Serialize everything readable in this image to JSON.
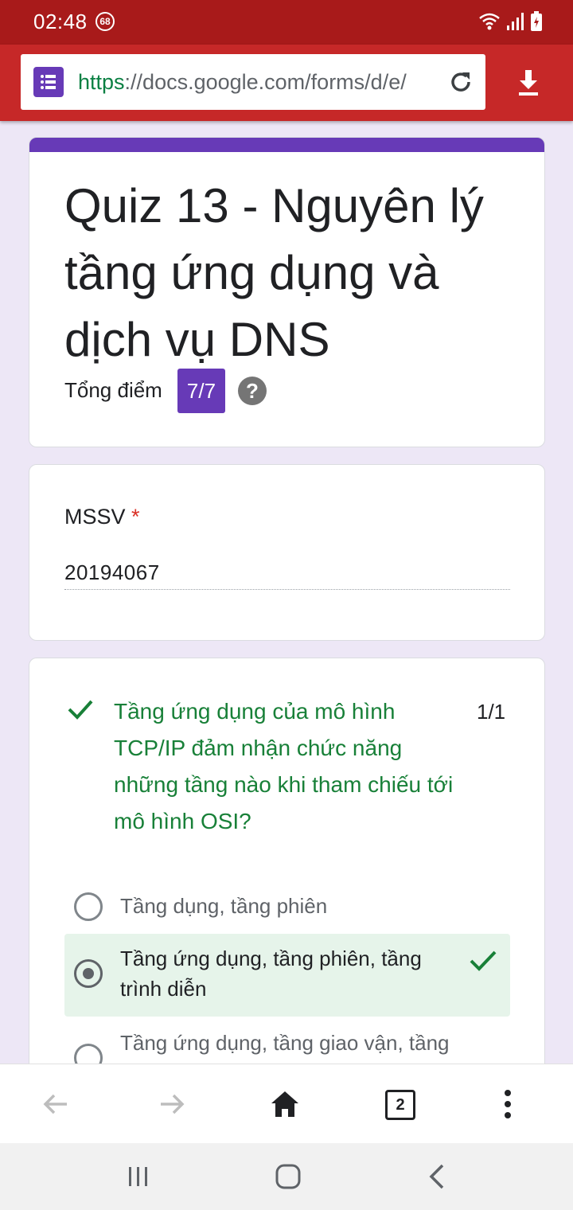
{
  "status_bar": {
    "time": "02:48",
    "notification_badge": "68"
  },
  "browser": {
    "url_scheme": "https",
    "url_rest": "://docs.google.com/forms/d/e/",
    "toolbar_color": "#c62828"
  },
  "form": {
    "title": "Quiz 13 - Nguyên lý tầng ứng dụng và dịch vụ DNS",
    "score_label": "Tổng điểm",
    "score_value": "7/7",
    "help_symbol": "?",
    "accent_color": "#673ab7"
  },
  "mssv": {
    "label": "MSSV",
    "required_mark": "*",
    "value": "20194067"
  },
  "question": {
    "text": "Tầng ứng dụng của mô hình TCP/IP đảm nhận chức năng những tầng nào khi tham chiếu tới mô hình OSI?",
    "points": "1/1",
    "status": "correct",
    "options": [
      {
        "label": "Tầng dụng, tầng phiên",
        "selected": false
      },
      {
        "label": "Tầng ứng dụng, tầng phiên, tầng trình diễn",
        "selected": true,
        "correct": true
      },
      {
        "label": "Tầng ứng dụng, tầng giao vận, tầng",
        "selected": false
      }
    ]
  },
  "bottom_toolbar": {
    "tab_count": "2"
  },
  "icons": {
    "forms": "forms-icon",
    "reload": "reload-icon",
    "download": "download-icon",
    "help": "help-icon",
    "check": "check-icon",
    "back": "back-arrow-icon",
    "forward": "forward-arrow-icon",
    "home": "home-icon",
    "menu": "more-vert-icon"
  }
}
